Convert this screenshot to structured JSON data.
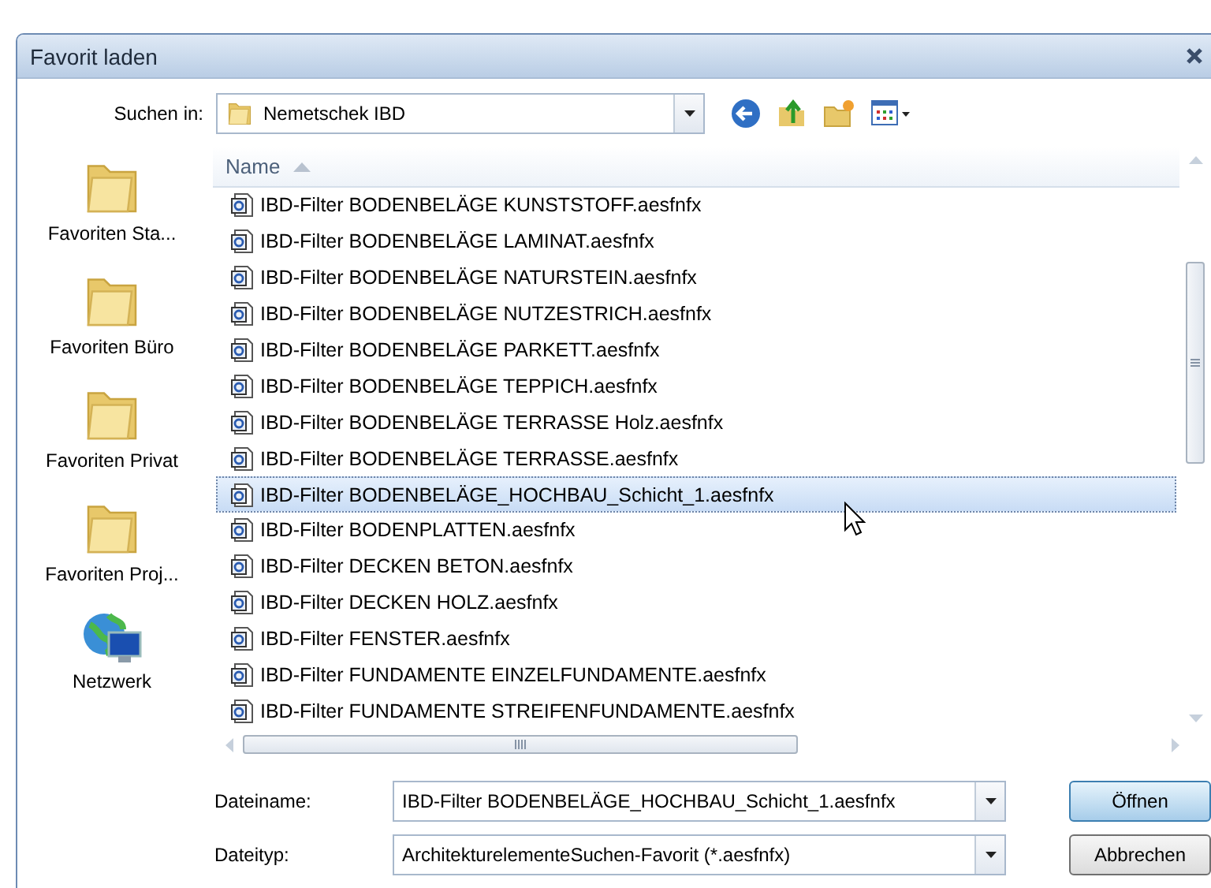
{
  "window": {
    "title": "Favorit laden"
  },
  "look_in": {
    "label": "Suchen in:",
    "value": "Nemetschek IBD"
  },
  "places": [
    {
      "label": "Favoriten Sta...",
      "kind": "folder"
    },
    {
      "label": "Favoriten Büro",
      "kind": "folder"
    },
    {
      "label": "Favoriten Privat",
      "kind": "folder"
    },
    {
      "label": "Favoriten Proj...",
      "kind": "folder"
    },
    {
      "label": "Netzwerk",
      "kind": "network"
    }
  ],
  "file_list": {
    "column_header": "Name",
    "rows": [
      {
        "name": "IBD-Filter BODENBELÄGE KUNSTSTOFF.aesfnfx",
        "selected": false
      },
      {
        "name": "IBD-Filter BODENBELÄGE LAMINAT.aesfnfx",
        "selected": false
      },
      {
        "name": "IBD-Filter BODENBELÄGE NATURSTEIN.aesfnfx",
        "selected": false
      },
      {
        "name": "IBD-Filter BODENBELÄGE NUTZESTRICH.aesfnfx",
        "selected": false
      },
      {
        "name": "IBD-Filter BODENBELÄGE PARKETT.aesfnfx",
        "selected": false
      },
      {
        "name": "IBD-Filter BODENBELÄGE TEPPICH.aesfnfx",
        "selected": false
      },
      {
        "name": "IBD-Filter BODENBELÄGE TERRASSE Holz.aesfnfx",
        "selected": false
      },
      {
        "name": "IBD-Filter BODENBELÄGE TERRASSE.aesfnfx",
        "selected": false
      },
      {
        "name": "IBD-Filter BODENBELÄGE_HOCHBAU_Schicht_1.aesfnfx",
        "selected": true
      },
      {
        "name": "IBD-Filter BODENPLATTEN.aesfnfx",
        "selected": false
      },
      {
        "name": "IBD-Filter DECKEN BETON.aesfnfx",
        "selected": false
      },
      {
        "name": "IBD-Filter DECKEN HOLZ.aesfnfx",
        "selected": false
      },
      {
        "name": "IBD-Filter FENSTER.aesfnfx",
        "selected": false
      },
      {
        "name": "IBD-Filter FUNDAMENTE EINZELFUNDAMENTE.aesfnfx",
        "selected": false
      },
      {
        "name": "IBD-Filter FUNDAMENTE STREIFENFUNDAMENTE.aesfnfx",
        "selected": false
      }
    ]
  },
  "file_name": {
    "label": "Dateiname:",
    "value": "IBD-Filter BODENBELÄGE_HOCHBAU_Schicht_1.aesfnfx"
  },
  "file_type": {
    "label": "Dateityp:",
    "value": "ArchitekturelementeSuchen-Favorit (*.aesfnfx)"
  },
  "buttons": [
    {
      "label": "Öffnen",
      "default": true
    },
    {
      "label": "Abbrechen",
      "default": false
    }
  ]
}
